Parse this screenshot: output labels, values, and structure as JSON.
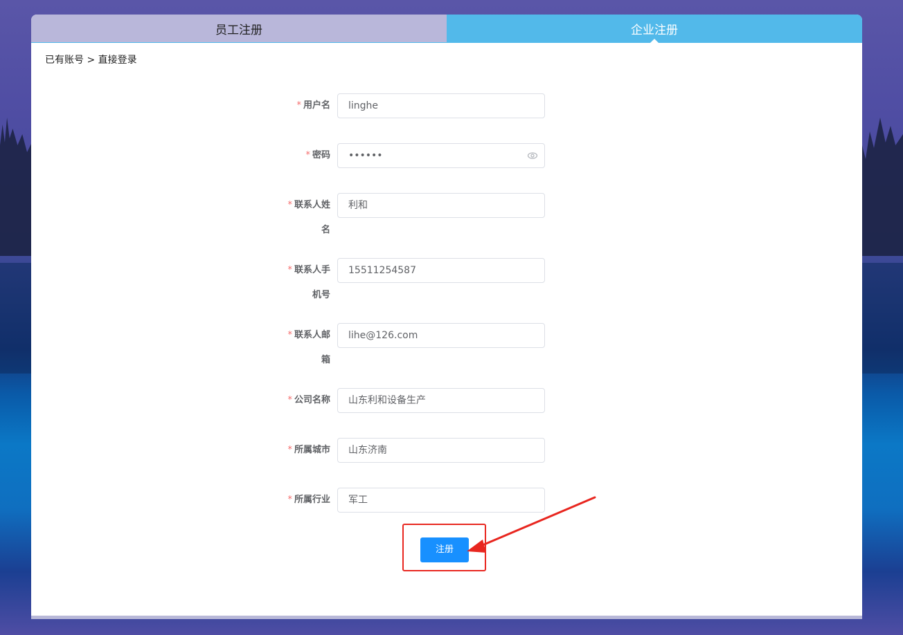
{
  "tabs": {
    "employee": "员工注册",
    "enterprise": "企业注册"
  },
  "login_link": "已有账号 > 直接登录",
  "form": {
    "required_mark": "*",
    "username": {
      "label": "用户名",
      "value": "linghe"
    },
    "password": {
      "label": "密码",
      "value": "••••••"
    },
    "contact_name": {
      "label_line1": "联系人姓",
      "label_line2": "名",
      "value": "利和"
    },
    "contact_phone": {
      "label_line1": "联系人手",
      "label_line2": "机号",
      "value": "15511254587"
    },
    "contact_email": {
      "label_line1": "联系人邮",
      "label_line2": "箱",
      "value": "lihe@126.com"
    },
    "company": {
      "label": "公司名称",
      "value": "山东利和设备生产"
    },
    "city": {
      "label": "所属城市",
      "value": "山东济南"
    },
    "industry": {
      "label": "所属行业",
      "value": "军工"
    }
  },
  "submit_label": "注册",
  "icons": {
    "password_toggle": "eye-icon",
    "annotation": "red-arrow-annotation"
  },
  "colors": {
    "tab_active": "#52b9ea",
    "tab_inactive": "#b9b7da",
    "primary_button": "#1890ff",
    "required": "#f56c6c",
    "annotation": "#e8261f"
  }
}
